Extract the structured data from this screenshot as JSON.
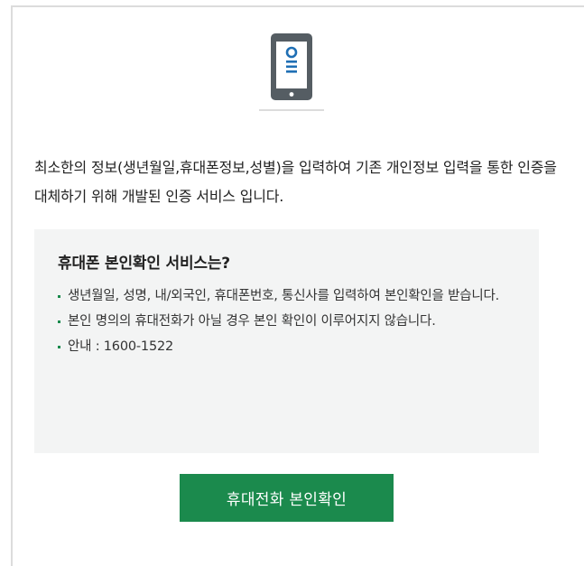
{
  "icon": "mobile-phone-icon",
  "description": "최소한의 정보(생년월일,휴대폰정보,성별)을 입력하여 기존 개인정보 입력을 통한 인증을 대체하기 위해 개발된 인증 서비스 입니다.",
  "info": {
    "title": "휴대폰 본인확인 서비스는?",
    "items": [
      "생년월일, 성명, 내/외국인, 휴대폰번호, 통신사를 입력하여 본인확인을 받습니다.",
      "본인 명의의 휴대전화가 아닐 경우 본인 확인이 이루어지지 않습니다.",
      "안내 : 1600-1522"
    ]
  },
  "button_label": "휴대전화 본인확인",
  "colors": {
    "accent": "#1b8a4d",
    "phone_body": "#555d63",
    "phone_screen": "#ffffff",
    "info_bg": "#f3f4f4",
    "frame_border": "#dcdcdc"
  }
}
